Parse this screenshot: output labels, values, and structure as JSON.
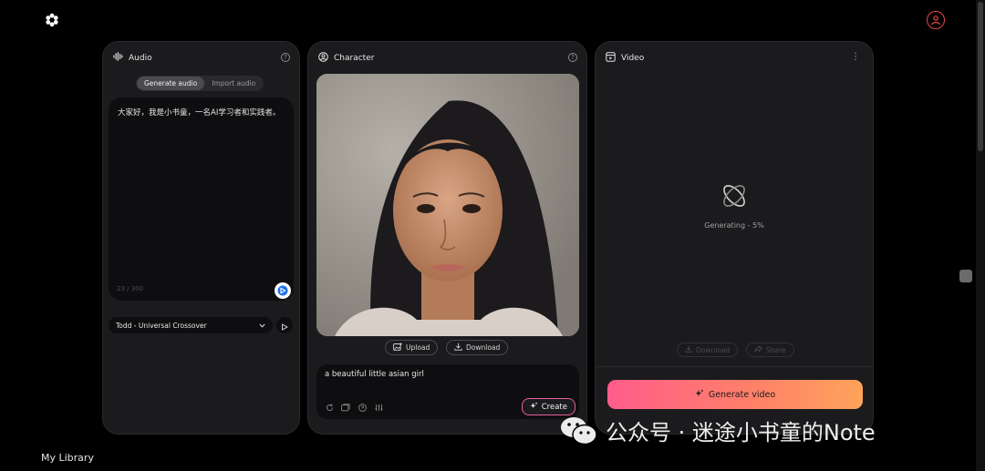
{
  "audio": {
    "title": "Audio",
    "tabs": [
      "Generate audio",
      "Import audio"
    ],
    "text": "大家好，我是小书童，一名AI学习者和实践者。",
    "char_count": "23 / 300",
    "voice": "Todd - Universal Crossover"
  },
  "character": {
    "title": "Character",
    "upload_label": "Upload",
    "download_label": "Download",
    "prompt": "a beautiful little asian girl",
    "create_label": "Create"
  },
  "video": {
    "title": "Video",
    "status": "Generating - 5%",
    "download_label": "Download",
    "share_label": "Share",
    "generate_label": "Generate video"
  },
  "library": {
    "title": "My Library"
  },
  "watermark": {
    "text": "公众号 · 迷途小书童的Note"
  },
  "colors": {
    "background": "#000000",
    "panel": "#1b1b1e",
    "accent_gradient_start": "#ff5c8a",
    "accent_gradient_end": "#ffa35a",
    "avatar_ring": "#e5484d"
  }
}
